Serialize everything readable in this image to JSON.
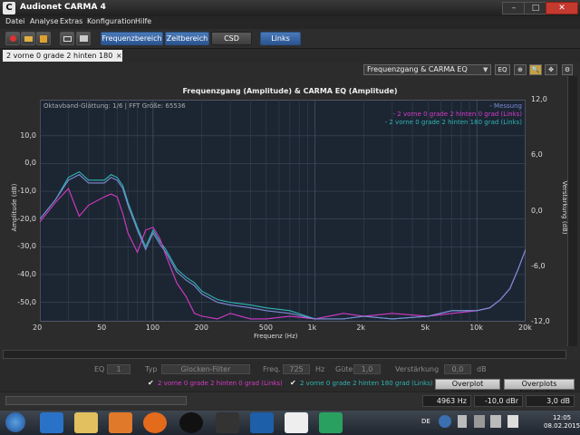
{
  "window": {
    "title": "Audionet CARMA 4",
    "app_icon": "C",
    "minimize": "–",
    "maximize": "□",
    "close": "✕"
  },
  "menu": [
    "Datei",
    "Analyse",
    "Extras",
    "Konfiguration",
    "Hilfe"
  ],
  "toolbar": {
    "icons": [
      "record-icon",
      "folder-open-icon",
      "save-icon",
      "snapshot-icon",
      "print-icon"
    ],
    "tabs": [
      {
        "label": "Frequenzbereich",
        "active": true
      },
      {
        "label": "Zeitbereich",
        "active": true
      },
      {
        "label": "CSD",
        "active": false
      },
      {
        "label": "Links",
        "active": true
      }
    ]
  },
  "document_tab": {
    "label": "2 vorne 0 grade 2 hinten 180 grad",
    "close": "×"
  },
  "view": {
    "selected": "Frequenzgang & CARMA EQ",
    "eq_button": "EQ",
    "zoom": "zoom-in-icon",
    "search": "magnifier-icon",
    "move": "move-icon",
    "settings": "gear-icon"
  },
  "plot": {
    "title": "Frequenzgang (Amplitude) & CARMA EQ (Amplitude)",
    "info": "Oktavband-Glättung: 1/6 | FFT Größe: 65536",
    "legend": [
      {
        "label": "- Messung",
        "color": "#7e8bd6"
      },
      {
        "label": "- 2 vorne 0 grade 2 hinten 0 grad (Links)",
        "color": "#d63ac8"
      },
      {
        "label": "- 2 vorne 0 grade 2 hinten 180 grad (Links)",
        "color": "#2fb5b3"
      }
    ]
  },
  "chart_data": {
    "type": "line",
    "xlabel": "Frequenz (Hz)",
    "ylabel": "Amplitude (dB)",
    "y2label": "Verstärkung (dB)",
    "xscale": "log",
    "xlim": [
      20,
      20000
    ],
    "ylim": [
      -57,
      23
    ],
    "y2lim": [
      -12,
      12
    ],
    "x_ticks": [
      "20",
      "50",
      "100",
      "200",
      "500",
      "1k",
      "2k",
      "5k",
      "10k",
      "20k"
    ],
    "y_ticks": [
      "10,0",
      "0,0",
      "-10,0",
      "-20,0",
      "-30,0",
      "-40,0",
      "-50,0"
    ],
    "y2_ticks": [
      "12,0",
      "6,0",
      "0,0",
      "-6,0",
      "-12,0"
    ],
    "grid": true,
    "legend_position": "top-right",
    "series": [
      {
        "name": "2 vorne 0 grade 2 hinten 180 grad (Links)",
        "color": "#2fb5b3",
        "x": [
          20,
          25,
          30,
          35,
          40,
          50,
          55,
          60,
          65,
          70,
          80,
          90,
          100,
          110,
          120,
          140,
          160,
          180,
          200,
          250,
          300,
          400,
          500,
          700,
          1000,
          1500,
          2000,
          3000,
          5000,
          7000,
          10000,
          12000,
          14000,
          16000,
          18000,
          20000
        ],
        "y": [
          -20,
          -13,
          -5,
          -3,
          -6,
          -6,
          -4,
          -5,
          -8,
          -14,
          -23,
          -30,
          -24,
          -28,
          -31,
          -38,
          -41,
          -43,
          -46,
          -49,
          -50,
          -51,
          -52,
          -53,
          -56,
          -56,
          -55,
          -56,
          -55,
          -53,
          -53,
          -52,
          -49,
          -45,
          -38,
          -31
        ]
      },
      {
        "name": "2 vorne 0 grade 2 hinten 0 grad (Links)",
        "color": "#d63ac8",
        "x": [
          20,
          25,
          30,
          35,
          40,
          50,
          55,
          60,
          65,
          70,
          80,
          90,
          100,
          110,
          120,
          140,
          160,
          180,
          200,
          250,
          300,
          400,
          500,
          700,
          1000,
          1500,
          2000,
          3000,
          5000,
          7000,
          10000,
          12000,
          14000,
          16000,
          18000,
          20000
        ],
        "y": [
          -21,
          -14,
          -9,
          -19,
          -15,
          -12,
          -11,
          -12,
          -18,
          -25,
          -32,
          -24,
          -23,
          -27,
          -33,
          -43,
          -48,
          -54,
          -55,
          -56,
          -54,
          -56,
          -56,
          -55,
          -56,
          -54,
          -55,
          -54,
          -55,
          -54,
          -53,
          -52,
          -49,
          -45,
          -38,
          -31
        ]
      },
      {
        "name": "Messung",
        "color": "#7e8bd6",
        "x": [
          20,
          25,
          30,
          35,
          40,
          50,
          55,
          60,
          65,
          70,
          80,
          90,
          100,
          110,
          120,
          140,
          160,
          180,
          200,
          250,
          300,
          400,
          500,
          700,
          1000,
          1500,
          2000,
          3000,
          5000,
          7000,
          10000,
          12000,
          14000,
          16000,
          18000,
          20000
        ],
        "y": [
          -20,
          -13,
          -6,
          -4,
          -7,
          -7,
          -5,
          -6,
          -9,
          -15,
          -24,
          -31,
          -25,
          -29,
          -32,
          -39,
          -42,
          -44,
          -47,
          -50,
          -51,
          -52,
          -53,
          -54,
          -56,
          -56,
          -55,
          -56,
          -55,
          -53,
          -53,
          -52,
          -49,
          -45,
          -38,
          -31
        ]
      }
    ]
  },
  "controls": {
    "eq_label": "EQ",
    "eq_value": "1",
    "typ_label": "Typ",
    "typ_value": "Glocken-Filter",
    "freq_label": "Freq.",
    "freq_value": "725",
    "freq_unit": "Hz",
    "guete_label": "Güte",
    "guete_value": "1,0",
    "gain_label": "Verstärkung",
    "gain_value": "0,0",
    "gain_unit": "dB",
    "check1": "2 vorne 0 grade 2 hinten 0 grad (Links)",
    "check2": "2 vorne 0 grade 2 hinten 180 grad (Links)",
    "btn_overplot": "Overplot erzeugen",
    "btn_edit": "Overplots bearbeiten"
  },
  "status": {
    "freq": "4963 Hz",
    "level": "-10,0 dBr",
    "value": "3,0 dB"
  },
  "taskbar": {
    "lang": "DE",
    "time": "12:05",
    "date": "08.02.2015"
  }
}
